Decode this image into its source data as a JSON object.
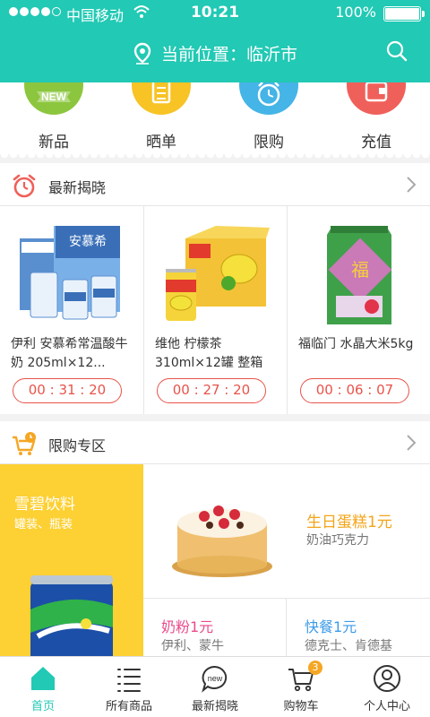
{
  "status_bar": {
    "carrier": "中国移动",
    "time": "10:21",
    "battery": "100%"
  },
  "header": {
    "location_label": "当前位置：临沂市"
  },
  "categories": [
    {
      "label": "新品",
      "color": "#8cc63f",
      "icon": "new-badge-icon",
      "icon_text": "NEW"
    },
    {
      "label": "晒单",
      "color": "#f7c325",
      "icon": "document-icon"
    },
    {
      "label": "限购",
      "color": "#45b4e6",
      "icon": "alarm-clock-icon"
    },
    {
      "label": "充值",
      "color": "#f0605a",
      "icon": "wallet-icon"
    }
  ],
  "latest_reveal": {
    "title": "最新揭晓",
    "products": [
      {
        "name": "伊利 安慕希常温酸牛奶 205ml×12...",
        "timer": "00 : 31 : 20",
        "image": "yogurt-box-image"
      },
      {
        "name": "维他 柠檬茶310ml×12罐 整箱装...",
        "timer": "00 : 27 : 20",
        "image": "lemon-tea-box-image"
      },
      {
        "name": "福临门 水晶大米5kg",
        "timer": "00 : 06 : 07",
        "image": "rice-bag-image"
      }
    ]
  },
  "flash_sale": {
    "title": "限购专区",
    "featured": {
      "title": "雪碧饮料",
      "subtitle": "罐装、瓶装"
    },
    "cake": {
      "title": "生日蛋糕1元",
      "subtitle": "奶油巧克力"
    },
    "cells": [
      {
        "title": "奶粉1元",
        "subtitle": "伊利、蒙牛",
        "color": "#e94b8c"
      },
      {
        "title": "快餐1元",
        "subtitle": "德克士、肯德基",
        "color": "#3d9be9"
      }
    ]
  },
  "tabbar": {
    "items": [
      {
        "label": "首页",
        "icon": "home-icon",
        "active": true
      },
      {
        "label": "所有商品",
        "icon": "list-icon"
      },
      {
        "label": "最新揭晓",
        "icon": "new-speech-icon",
        "icon_text": "new"
      },
      {
        "label": "购物车",
        "icon": "cart-icon",
        "badge": "3"
      },
      {
        "label": "个人中心",
        "icon": "user-icon"
      }
    ]
  },
  "colors": {
    "primary": "#22c9b4",
    "timer": "#e8534a",
    "sale_yellow": "#fdd033"
  }
}
